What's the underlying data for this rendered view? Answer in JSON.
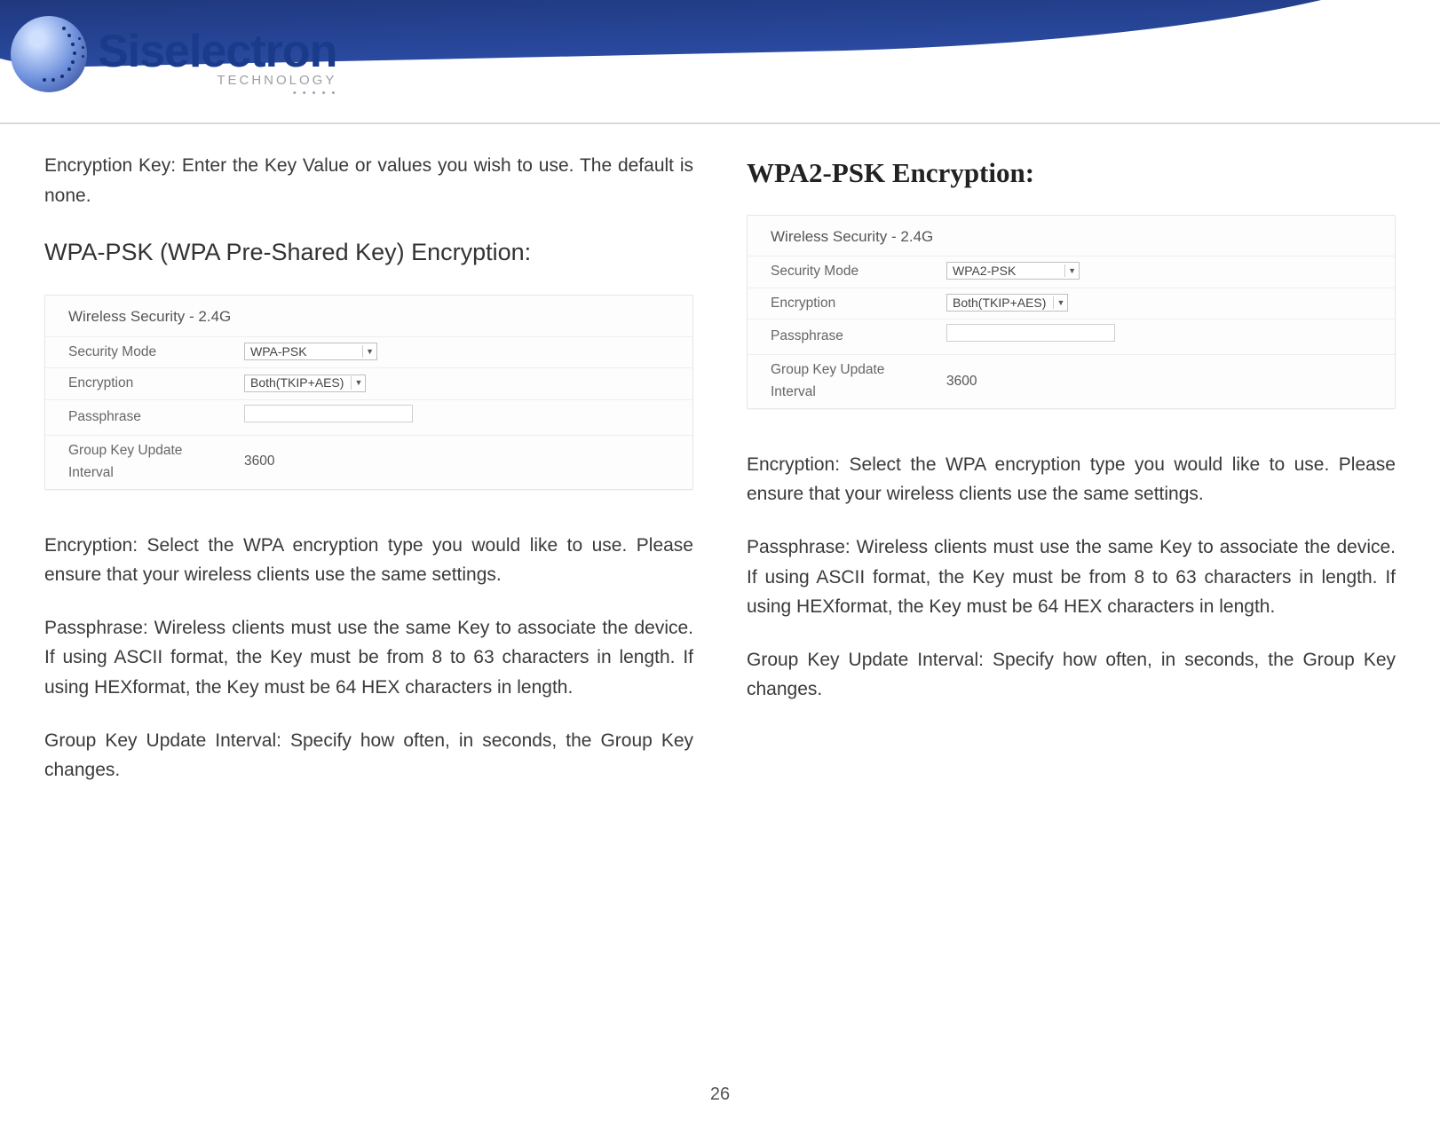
{
  "brand": {
    "name": "Siselectron",
    "sub": "TECHNOLOGY",
    "dots": "• • • • •"
  },
  "page_number": "26",
  "left": {
    "intro": "Encryption Key: Enter the Key Value or values you wish to use. The default is none.",
    "heading": "WPA-PSK (WPA Pre-Shared Key) Encryption:",
    "shot": {
      "title": "Wireless Security - 2.4G",
      "rows": {
        "security_mode": {
          "label": "Security Mode",
          "value": "WPA-PSK"
        },
        "encryption": {
          "label": "Encryption",
          "value": "Both(TKIP+AES)"
        },
        "passphrase": {
          "label": "Passphrase",
          "value": ""
        },
        "gkui": {
          "label": "Group Key Update Interval",
          "value": "3600"
        }
      }
    },
    "para_encryption": "Encryption: Select the WPA encryption type you would like to use. Please ensure that your wireless clients use the same settings.",
    "para_passphrase": "Passphrase: Wireless clients must use the same Key to associate the device. If using ASCII format, the Key must be from 8 to 63 characters in length. If using HEXformat, the Key must be 64 HEX characters in length.",
    "para_gkui": "Group Key Update Interval: Specify how often, in seconds, the Group Key changes."
  },
  "right": {
    "heading": "WPA2-PSK Encryption:",
    "shot": {
      "title": "Wireless Security - 2.4G",
      "rows": {
        "security_mode": {
          "label": "Security Mode",
          "value": "WPA2-PSK"
        },
        "encryption": {
          "label": "Encryption",
          "value": "Both(TKIP+AES)"
        },
        "passphrase": {
          "label": "Passphrase",
          "value": ""
        },
        "gkui": {
          "label": "Group Key Update Interval",
          "value": "3600"
        }
      }
    },
    "para_encryption": "Encryption: Select the WPA encryption type you would like to use. Please ensure that your wireless clients use the same settings.",
    "para_passphrase": "Passphrase: Wireless clients must use the same Key to associate the device. If using ASCII format, the Key must be from 8 to 63 characters in length. If using HEXformat, the Key must be 64 HEX characters in length.",
    "para_gkui": "Group Key Update Interval: Specify how often, in seconds, the Group Key changes."
  }
}
